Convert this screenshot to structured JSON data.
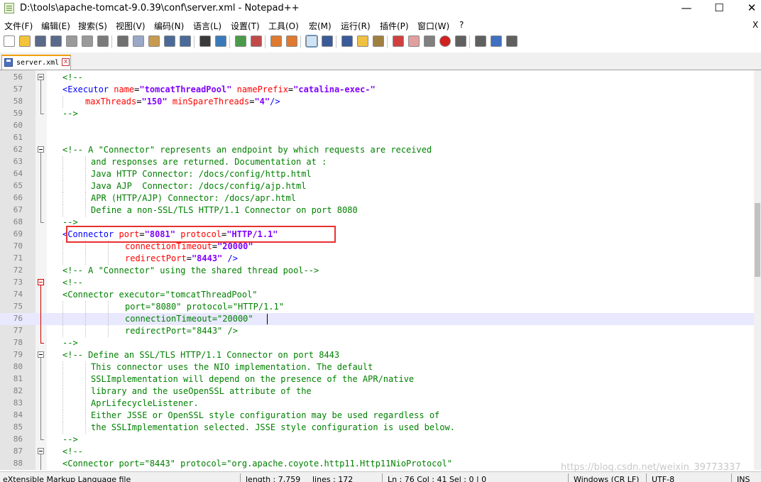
{
  "window": {
    "title": "D:\\tools\\apache-tomcat-9.0.39\\conf\\server.xml - Notepad++",
    "minimize_glyph": "—",
    "maximize_glyph": "☐",
    "close_glyph": "✕"
  },
  "menu": [
    {
      "id": "file",
      "label": "文件(F)"
    },
    {
      "id": "edit",
      "label": "编辑(E)"
    },
    {
      "id": "search",
      "label": "搜索(S)"
    },
    {
      "id": "view",
      "label": "视图(V)"
    },
    {
      "id": "encoding",
      "label": "编码(N)"
    },
    {
      "id": "language",
      "label": "语言(L)"
    },
    {
      "id": "settings",
      "label": "设置(T)"
    },
    {
      "id": "tools",
      "label": "工具(O)"
    },
    {
      "id": "macro",
      "label": "宏(M)"
    },
    {
      "id": "run",
      "label": "运行(R)"
    },
    {
      "id": "plugins",
      "label": "插件(P)"
    },
    {
      "id": "window",
      "label": "窗口(W)"
    },
    {
      "id": "help",
      "label": "?"
    }
  ],
  "menu_close_glyph": "X",
  "toolbar": [
    {
      "icon": "new-file-icon",
      "color": "#ffffff"
    },
    {
      "icon": "open-file-icon",
      "color": "#f3c33a"
    },
    {
      "icon": "save-icon",
      "color": "#5a6a8a"
    },
    {
      "icon": "save-all-icon",
      "color": "#5a6a8a"
    },
    {
      "icon": "close-icon",
      "color": "#9a9a9a"
    },
    {
      "icon": "close-all-icon",
      "color": "#9a9a9a"
    },
    {
      "icon": "print-icon",
      "color": "#7a7a7a"
    },
    {
      "icon": "cut-icon",
      "color": "#707070"
    },
    {
      "icon": "copy-icon",
      "color": "#9aa8c8"
    },
    {
      "icon": "paste-icon",
      "color": "#c89a50"
    },
    {
      "icon": "undo-icon",
      "color": "#4a6a9a"
    },
    {
      "icon": "redo-icon",
      "color": "#4a6a9a"
    },
    {
      "icon": "find-icon",
      "color": "#3a3a3a"
    },
    {
      "icon": "replace-icon",
      "color": "#3a7aba"
    },
    {
      "icon": "zoom-in-icon",
      "color": "#4a9a4a"
    },
    {
      "icon": "zoom-out-icon",
      "color": "#c04a4a"
    },
    {
      "icon": "sync-vertical-icon",
      "color": "#e07a30"
    },
    {
      "icon": "sync-horizontal-icon",
      "color": "#e07a30"
    },
    {
      "icon": "word-wrap-icon",
      "color": "#3a5a9a"
    },
    {
      "icon": "show-all-chars-icon",
      "color": "#3a5a9a"
    },
    {
      "icon": "indent-guide-icon",
      "color": "#3a5a9a"
    },
    {
      "icon": "user-language-icon",
      "color": "#f0c040"
    },
    {
      "icon": "document-map-icon",
      "color": "#a08040"
    },
    {
      "icon": "function-list-icon",
      "color": "#d04040"
    },
    {
      "icon": "folder-workspace-icon",
      "color": "#e0a0a0"
    },
    {
      "icon": "monitoring-icon",
      "color": "#808080"
    },
    {
      "icon": "record-macro-icon",
      "color": "#d02020"
    },
    {
      "icon": "stop-macro-icon",
      "color": "#606060"
    },
    {
      "icon": "play-macro-icon",
      "color": "#606060"
    },
    {
      "icon": "run-macro-multiple-icon",
      "color": "#4070c0"
    },
    {
      "icon": "save-macro-icon",
      "color": "#606060"
    }
  ],
  "tab": {
    "label": "server.xml",
    "close_glyph": "x"
  },
  "editor": {
    "current_line": 76,
    "lines": [
      {
        "n": "56",
        "fold": "open",
        "ind": 2,
        "seg": [
          [
            "c",
            "<!--"
          ]
        ]
      },
      {
        "n": "57",
        "ind": 2,
        "seg": [
          [
            "t",
            "<Executor "
          ],
          [
            "a",
            "name"
          ],
          [
            "p",
            "="
          ],
          [
            "v",
            "\"tomcatThreadPool\""
          ],
          [
            "p",
            " "
          ],
          [
            "a",
            "namePrefix"
          ],
          [
            "p",
            "="
          ],
          [
            "v",
            "\"catalina-exec-\""
          ]
        ]
      },
      {
        "n": "58",
        "ind": 6,
        "seg": [
          [
            "a",
            "maxThreads"
          ],
          [
            "p",
            "="
          ],
          [
            "v",
            "\"150\""
          ],
          [
            "p",
            " "
          ],
          [
            "a",
            "minSpareThreads"
          ],
          [
            "p",
            "="
          ],
          [
            "v",
            "\"4\""
          ],
          [
            "t",
            "/>"
          ]
        ]
      },
      {
        "n": "59",
        "fold": "close",
        "ind": 2,
        "seg": [
          [
            "c",
            "-->"
          ]
        ]
      },
      {
        "n": "60",
        "ind": 0,
        "seg": []
      },
      {
        "n": "61",
        "ind": 0,
        "seg": []
      },
      {
        "n": "62",
        "fold": "open",
        "ind": 2,
        "seg": [
          [
            "c",
            "<!-- A \"Connector\" represents an endpoint by which requests are received"
          ]
        ]
      },
      {
        "n": "63",
        "ind": 7,
        "seg": [
          [
            "c",
            "and responses are returned. Documentation at :"
          ]
        ]
      },
      {
        "n": "64",
        "ind": 7,
        "seg": [
          [
            "c",
            "Java HTTP Connector: /docs/config/http.html"
          ]
        ]
      },
      {
        "n": "65",
        "ind": 7,
        "seg": [
          [
            "c",
            "Java AJP  Connector: /docs/config/ajp.html"
          ]
        ]
      },
      {
        "n": "66",
        "ind": 7,
        "seg": [
          [
            "c",
            "APR (HTTP/AJP) Connector: /docs/apr.html"
          ]
        ]
      },
      {
        "n": "67",
        "ind": 7,
        "seg": [
          [
            "c",
            "Define a non-SSL/TLS HTTP/1.1 Connector on port 8080"
          ]
        ]
      },
      {
        "n": "68",
        "fold": "close",
        "ind": 2,
        "seg": [
          [
            "c",
            "-->"
          ]
        ]
      },
      {
        "n": "69",
        "ind": 2,
        "seg": [
          [
            "t",
            "<Connector "
          ],
          [
            "a",
            "port"
          ],
          [
            "p",
            "="
          ],
          [
            "v",
            "\"8081\""
          ],
          [
            "p",
            " "
          ],
          [
            "a",
            "protocol"
          ],
          [
            "p",
            "="
          ],
          [
            "v",
            "\"HTTP/1.1\""
          ]
        ]
      },
      {
        "n": "70",
        "ind": 13,
        "seg": [
          [
            "a",
            "connectionTimeout"
          ],
          [
            "p",
            "="
          ],
          [
            "v",
            "\"20000\""
          ]
        ]
      },
      {
        "n": "71",
        "ind": 13,
        "seg": [
          [
            "a",
            "redirectPort"
          ],
          [
            "p",
            "="
          ],
          [
            "v",
            "\"8443\""
          ],
          [
            "p",
            " "
          ],
          [
            "t",
            "/>"
          ]
        ]
      },
      {
        "n": "72",
        "ind": 2,
        "seg": [
          [
            "c",
            "<!-- A \"Connector\" using the shared thread pool-->"
          ]
        ]
      },
      {
        "n": "73",
        "fold": "open-red",
        "ind": 2,
        "seg": [
          [
            "c",
            "<!--"
          ]
        ]
      },
      {
        "n": "74",
        "ind": 2,
        "seg": [
          [
            "c",
            "<Connector executor=\"tomcatThreadPool\""
          ]
        ]
      },
      {
        "n": "75",
        "ind": 13,
        "seg": [
          [
            "c",
            "port=\"8080\" protocol=\"HTTP/1.1\""
          ]
        ]
      },
      {
        "n": "76",
        "ind": 13,
        "seg": [
          [
            "c",
            "connectionTimeout=\"20000\""
          ]
        ]
      },
      {
        "n": "77",
        "ind": 13,
        "seg": [
          [
            "c",
            "redirectPort=\"8443\" />"
          ]
        ]
      },
      {
        "n": "78",
        "fold": "close-red",
        "ind": 2,
        "seg": [
          [
            "c",
            "-->"
          ]
        ]
      },
      {
        "n": "79",
        "fold": "open",
        "ind": 2,
        "seg": [
          [
            "c",
            "<!-- Define an SSL/TLS HTTP/1.1 Connector on port 8443"
          ]
        ]
      },
      {
        "n": "80",
        "ind": 7,
        "seg": [
          [
            "c",
            "This connector uses the NIO implementation. The default"
          ]
        ]
      },
      {
        "n": "81",
        "ind": 7,
        "seg": [
          [
            "c",
            "SSLImplementation will depend on the presence of the APR/native"
          ]
        ]
      },
      {
        "n": "82",
        "ind": 7,
        "seg": [
          [
            "c",
            "library and the useOpenSSL attribute of the"
          ]
        ]
      },
      {
        "n": "83",
        "ind": 7,
        "seg": [
          [
            "c",
            "AprLifecycleListener."
          ]
        ]
      },
      {
        "n": "84",
        "ind": 7,
        "seg": [
          [
            "c",
            "Either JSSE or OpenSSL style configuration may be used regardless of"
          ]
        ]
      },
      {
        "n": "85",
        "ind": 7,
        "seg": [
          [
            "c",
            "the SSLImplementation selected. JSSE style configuration is used below."
          ]
        ]
      },
      {
        "n": "86",
        "fold": "close",
        "ind": 2,
        "seg": [
          [
            "c",
            "-->"
          ]
        ]
      },
      {
        "n": "87",
        "fold": "open",
        "ind": 2,
        "seg": [
          [
            "c",
            "<!--"
          ]
        ]
      },
      {
        "n": "88",
        "ind": 2,
        "seg": [
          [
            "c",
            "<Connector port=\"8443\" protocol=\"org.apache.coyote.http11.Http11NioProtocol\""
          ]
        ]
      }
    ]
  },
  "status": {
    "file_type": "eXtensible Markup Language file",
    "length": "length : 7,759",
    "lines": "lines : 172",
    "position": "Ln : 76    Col : 41    Sel : 0 | 0",
    "eol": "Windows (CR LF)",
    "encoding": "UTF-8",
    "mode": "INS"
  },
  "watermark": "https://blog.csdn.net/weixin_39773337"
}
